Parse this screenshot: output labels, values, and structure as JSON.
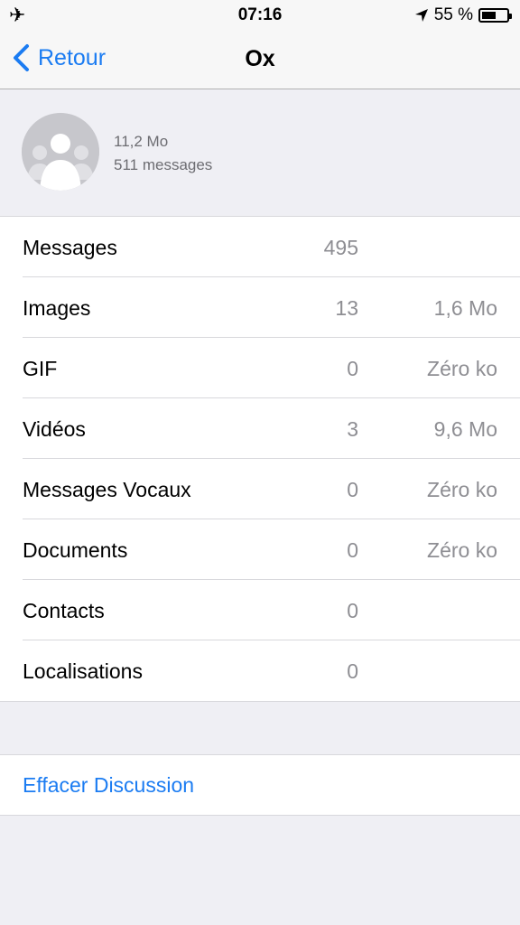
{
  "status_bar": {
    "time": "07:16",
    "battery_text": "55 %",
    "battery_level": 0.55
  },
  "nav": {
    "back_label": "Retour",
    "title": "Ox"
  },
  "chat": {
    "size": "11,2 Mo",
    "messages": "511 messages"
  },
  "rows": [
    {
      "label": "Messages",
      "count": "495",
      "size": ""
    },
    {
      "label": "Images",
      "count": "13",
      "size": "1,6 Mo"
    },
    {
      "label": "GIF",
      "count": "0",
      "size": "Zéro ko"
    },
    {
      "label": "Vidéos",
      "count": "3",
      "size": "9,6 Mo"
    },
    {
      "label": "Messages Vocaux",
      "count": "0",
      "size": "Zéro ko"
    },
    {
      "label": "Documents",
      "count": "0",
      "size": "Zéro ko"
    },
    {
      "label": "Contacts",
      "count": "0",
      "size": ""
    },
    {
      "label": "Localisations",
      "count": "0",
      "size": ""
    }
  ],
  "action": {
    "label": "Effacer Discussion"
  },
  "colors": {
    "accent": "#1b7cf2",
    "secondary_text": "#8e8e93",
    "background": "#efeff4"
  }
}
